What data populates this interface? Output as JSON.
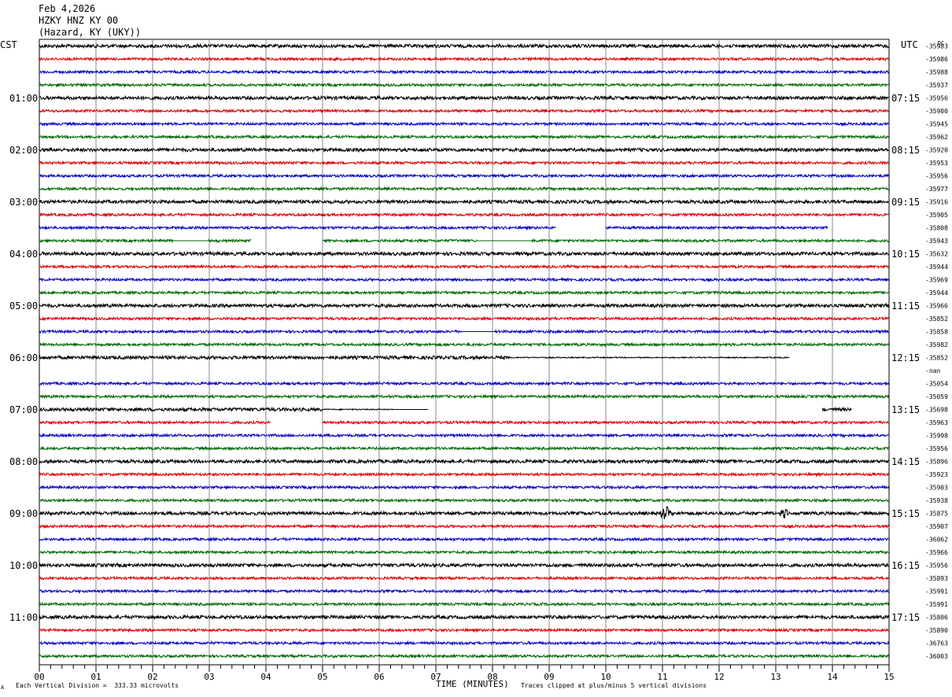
{
  "header": {
    "date": "Feb 4,2026",
    "station": "HZKY HNZ KY 00",
    "location": "(Hazard, KY (UKY))"
  },
  "chart_data": {
    "type": "line",
    "left_axis_label": "CST",
    "right_axis_label": "UTC",
    "dc_label": "DC",
    "x_label": "TIME (MINUTES)",
    "x_ticks": [
      "00",
      "01",
      "02",
      "03",
      "04",
      "05",
      "06",
      "07",
      "08",
      "09",
      "10",
      "11",
      "12",
      "13",
      "14",
      "15"
    ],
    "xlim": [
      0,
      15
    ],
    "left_hour_labels": [
      {
        "row": 4,
        "text": "01:00"
      },
      {
        "row": 8,
        "text": "02:00"
      },
      {
        "row": 12,
        "text": "03:00"
      },
      {
        "row": 16,
        "text": "04:00"
      },
      {
        "row": 20,
        "text": "05:00"
      },
      {
        "row": 24,
        "text": "06:00"
      },
      {
        "row": 28,
        "text": "07:00"
      },
      {
        "row": 32,
        "text": "08:00"
      },
      {
        "row": 36,
        "text": "09:00"
      },
      {
        "row": 40,
        "text": "10:00"
      },
      {
        "row": 44,
        "text": "11:00"
      }
    ],
    "right_hour_labels": [
      {
        "row": 4,
        "text": "07:15"
      },
      {
        "row": 8,
        "text": "08:15"
      },
      {
        "row": 12,
        "text": "09:15"
      },
      {
        "row": 16,
        "text": "10:15"
      },
      {
        "row": 20,
        "text": "11:15"
      },
      {
        "row": 24,
        "text": "12:15"
      },
      {
        "row": 28,
        "text": "13:15"
      },
      {
        "row": 32,
        "text": "14:15"
      },
      {
        "row": 36,
        "text": "15:15"
      },
      {
        "row": 40,
        "text": "16:15"
      },
      {
        "row": 44,
        "text": "17:15"
      }
    ],
    "row_colors": [
      "#000000",
      "#dd0000",
      "#0000cc",
      "#006600"
    ],
    "dc_values": [
      "-35983",
      "-35986",
      "-35988",
      "-35937",
      "-35956",
      "-35900",
      "-35945",
      "-35962",
      "-35920",
      "-35953",
      "-35956",
      "-35977",
      "-35916",
      "-35905",
      "-35808",
      "-35943",
      "-35632",
      "-35944",
      "-35969",
      "-35944",
      "-35966",
      "-35852",
      "-35858",
      "-35982",
      "-35852",
      "-nan",
      "-35054",
      "-35059",
      "-35698",
      "-35963",
      "-35998",
      "-35956",
      "-35896",
      "-35923",
      "-35903",
      "-35938",
      "-35875",
      "-35907",
      "-36062",
      "-35966",
      "-35956",
      "-35893",
      "-35991",
      "-35991",
      "-35806",
      "-35890",
      "-36763",
      "-36003"
    ],
    "gaps": [
      {
        "row": 15,
        "segments": [
          [
            2.35,
            2.98,
            "flat"
          ],
          [
            3.75,
            5.0,
            "gap"
          ],
          [
            7.72,
            8.7,
            "flat"
          ]
        ]
      },
      {
        "row": 14,
        "segments": [
          [
            9.12,
            10.0,
            "gap"
          ],
          [
            13.92,
            15.0,
            "gap"
          ]
        ]
      },
      {
        "row": 22,
        "segments": [
          [
            7.45,
            8.05,
            "flat"
          ]
        ]
      },
      {
        "row": 24,
        "segments": [
          [
            8.3,
            13.25,
            "thin"
          ],
          [
            13.25,
            15.0,
            "gap"
          ]
        ]
      },
      {
        "row": 25,
        "segments": [
          [
            0.0,
            15.0,
            "gap"
          ]
        ]
      },
      {
        "row": 28,
        "segments": [
          [
            5.0,
            6.25,
            "thin"
          ],
          [
            6.25,
            6.87,
            "flat"
          ],
          [
            6.87,
            13.82,
            "gap"
          ],
          [
            14.35,
            15.0,
            "gap"
          ]
        ]
      },
      {
        "row": 29,
        "segments": [
          [
            4.08,
            5.0,
            "gap"
          ]
        ]
      }
    ],
    "events": [
      {
        "row": 36,
        "minute": 11.05,
        "amplitude": 1.3
      },
      {
        "row": 36,
        "minute": 13.15,
        "amplitude": 0.8
      }
    ],
    "footer_left": "Each Vertical Division =  333.33 microvolts",
    "footer_right": "Traces clipped at plus/minus 5 vertical divisions",
    "corner_mark": "A"
  }
}
